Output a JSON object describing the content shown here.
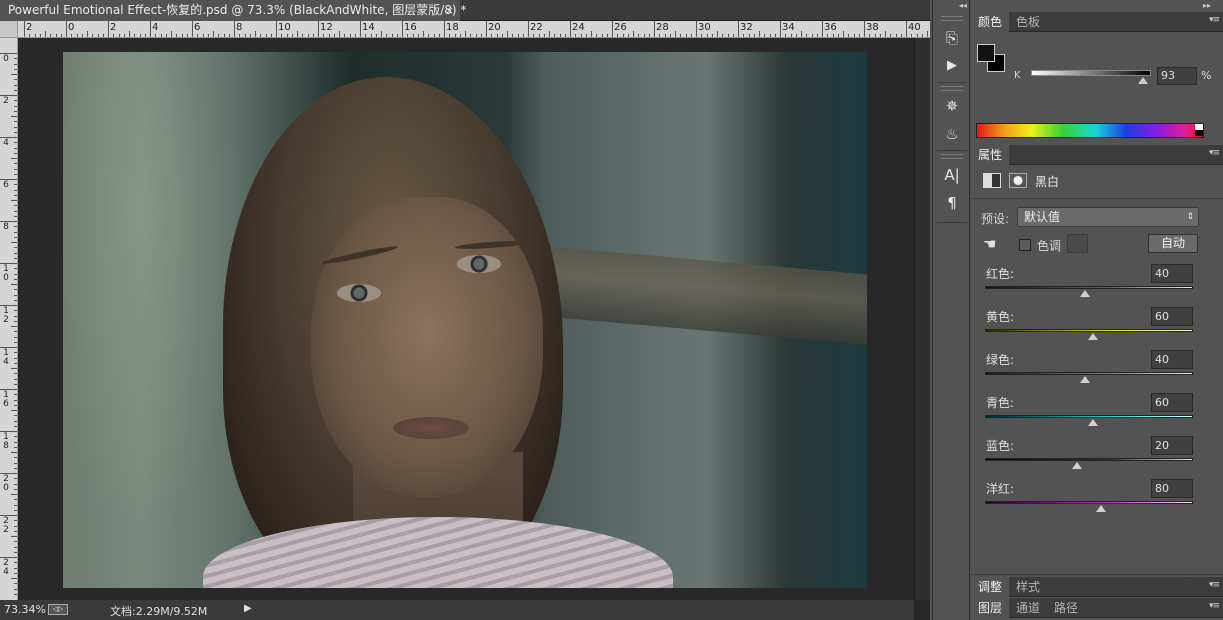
{
  "document": {
    "tab_title": "Powerful Emotional Effect-恢复的.psd @ 73.3% (BlackAndWhite, 图层蒙版/8) *",
    "close_glyph": "×",
    "ruler_h_labels": [
      "2",
      "0",
      "2",
      "4",
      "6",
      "8",
      "10",
      "12",
      "14",
      "16",
      "18",
      "20",
      "22",
      "24",
      "26",
      "28",
      "30",
      "32",
      "34",
      "36",
      "38",
      "40"
    ],
    "ruler_v_labels": [
      "0",
      "2",
      "4",
      "6",
      "8",
      "10",
      "12",
      "14",
      "16",
      "18",
      "20",
      "22",
      "24"
    ]
  },
  "status": {
    "zoom": "73.34%",
    "doc_size": "文档:2.29M/9.52M",
    "arrow": "▶",
    "icon_text": "◁▷"
  },
  "tool_strip": {
    "collapse": "◂◂",
    "buttons": [
      {
        "icon": "history-icon",
        "glyph": "⎘"
      },
      {
        "icon": "play-icon",
        "glyph": "▶"
      },
      {
        "icon": "brush-settings-icon",
        "glyph": "✵"
      },
      {
        "icon": "brush-presets-icon",
        "glyph": "♨"
      },
      {
        "icon": "character-icon",
        "glyph": "A|"
      },
      {
        "icon": "paragraph-icon",
        "glyph": "¶"
      }
    ]
  },
  "panels": {
    "collapse": "▸▸",
    "color": {
      "tabs": [
        "颜色",
        "色板"
      ],
      "channel_label": "K",
      "k_value": "93",
      "k_fraction": 0.93,
      "unit": "%"
    },
    "properties": {
      "tab": "属性",
      "title": "黑白",
      "preset_label": "预设:",
      "preset_value": "默认值",
      "tint_label": "色调",
      "auto_label": "自动",
      "sliders": [
        {
          "label": "红色:",
          "value": "40",
          "colors": [
            "#3a0000",
            "#ff2020",
            "#ffe0e0"
          ]
        },
        {
          "label": "黄色:",
          "value": "60",
          "colors": [
            "#2a2a00",
            "#e8e820",
            "#ffffe0"
          ]
        },
        {
          "label": "绿色:",
          "value": "40",
          "colors": [
            "#002a00",
            "#20c020",
            "#e0ffe0"
          ]
        },
        {
          "label": "青色:",
          "value": "60",
          "colors": [
            "#002a2a",
            "#20d8d8",
            "#e0ffff"
          ]
        },
        {
          "label": "蓝色:",
          "value": "20",
          "colors": [
            "#00002a",
            "#2020e0",
            "#e0e0ff"
          ]
        },
        {
          "label": "洋红:",
          "value": "80",
          "colors": [
            "#2a002a",
            "#d020d0",
            "#ffe0ff"
          ]
        }
      ],
      "slider_min": -200,
      "slider_max": 300
    },
    "adjustments_tabs": [
      "调整",
      "样式"
    ],
    "layers_tabs": [
      "图层",
      "通道",
      "路径"
    ],
    "menu_glyph": "▾≡"
  }
}
